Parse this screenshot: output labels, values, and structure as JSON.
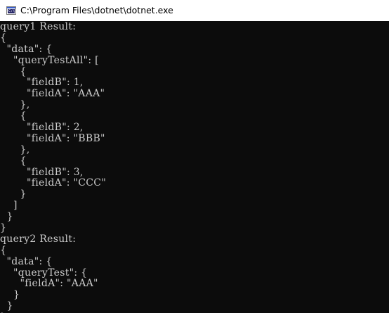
{
  "window": {
    "title": "C:\\Program Files\\dotnet\\dotnet.exe",
    "icon": "console-app-icon",
    "icon_glyph": "C:\\"
  },
  "console": {
    "background": "#0c0c0c",
    "foreground": "#cccccc",
    "lines": [
      "query1 Result:",
      "{",
      "  \"data\": {",
      "    \"queryTestAll\": [",
      "      {",
      "        \"fieldB\": 1,",
      "        \"fieldA\": \"AAA\"",
      "      },",
      "      {",
      "        \"fieldB\": 2,",
      "        \"fieldA\": \"BBB\"",
      "      },",
      "      {",
      "        \"fieldB\": 3,",
      "        \"fieldA\": \"CCC\"",
      "      }",
      "    ]",
      "  }",
      "}",
      "query2 Result:",
      "{",
      "  \"data\": {",
      "    \"queryTest\": {",
      "      \"fieldA\": \"AAA\"",
      "    }",
      "  }",
      "}"
    ]
  }
}
